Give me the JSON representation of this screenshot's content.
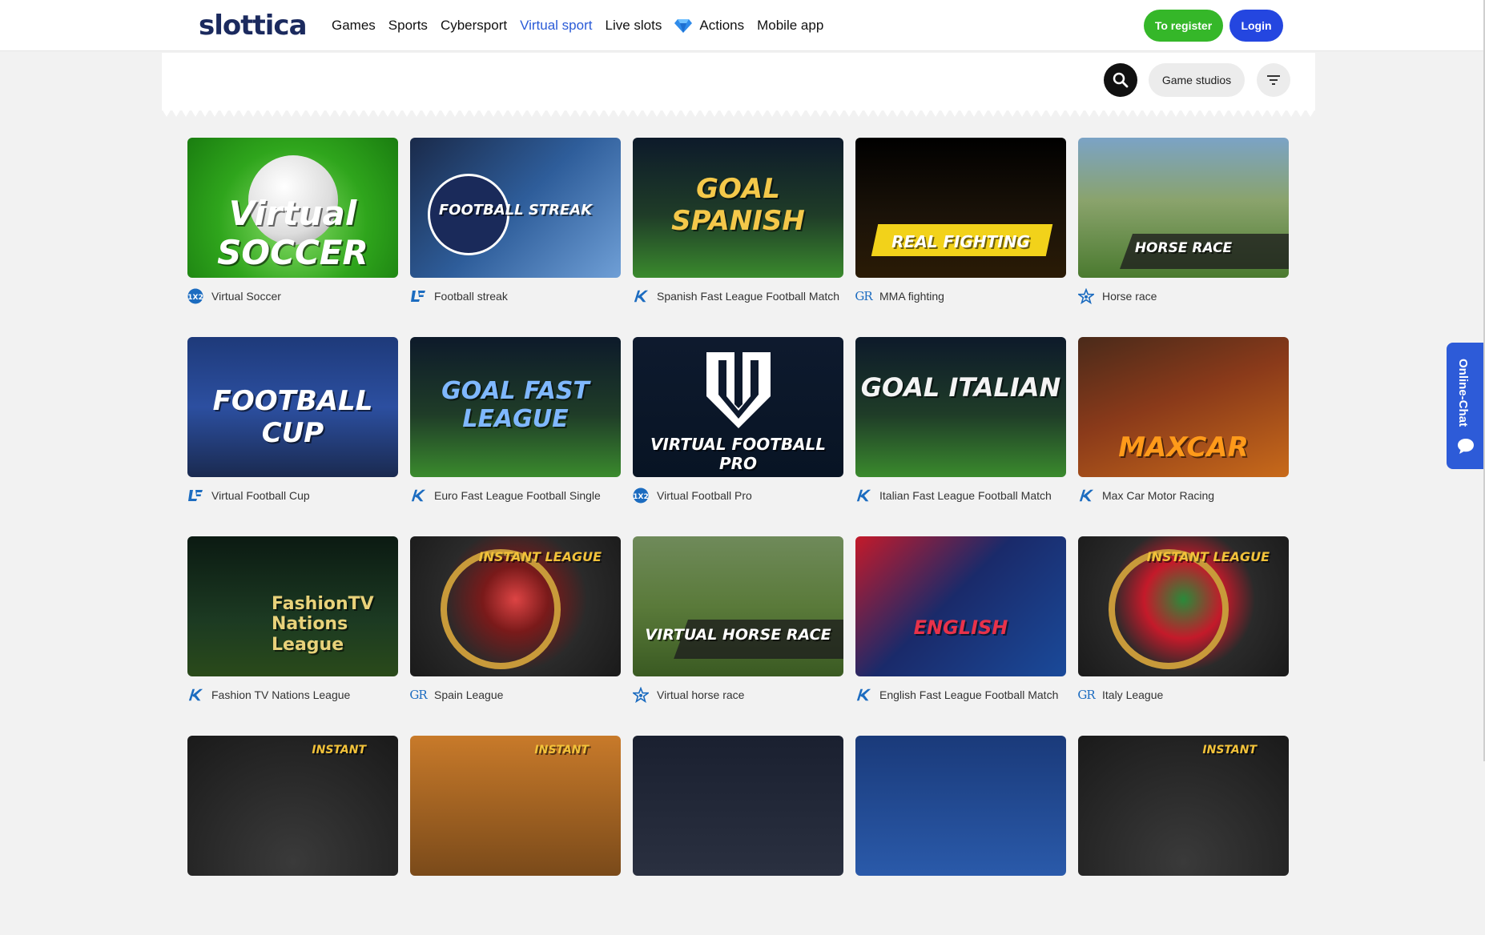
{
  "header": {
    "logo_text": "slottica",
    "nav": [
      {
        "label": "Games",
        "active": false
      },
      {
        "label": "Sports",
        "active": false
      },
      {
        "label": "Cybersport",
        "active": false
      },
      {
        "label": "Virtual sport",
        "active": true
      },
      {
        "label": "Live slots",
        "active": false
      },
      {
        "label": "Actions",
        "active": false,
        "icon": "diamond-icon"
      },
      {
        "label": "Mobile app",
        "active": false
      }
    ],
    "register_label": "To register",
    "login_label": "Login"
  },
  "filters": {
    "studios_label": "Game studios"
  },
  "games": [
    {
      "name": "Virtual Soccer",
      "provider": "1x2",
      "art": "Virtual SOCCER"
    },
    {
      "name": "Football streak",
      "provider": "LE",
      "art": "FOOTBALL STREAK"
    },
    {
      "name": "Spanish Fast League Football Match",
      "provider": "K",
      "art": "GOAL SPANISH"
    },
    {
      "name": "MMA fighting",
      "provider": "GR",
      "art": "REAL FIGHTING"
    },
    {
      "name": "Horse race",
      "provider": "star",
      "art": "HORSE RACE"
    },
    {
      "name": "Virtual Football Cup",
      "provider": "LE",
      "art": "FOOTBALL CUP"
    },
    {
      "name": "Euro Fast League Football Single",
      "provider": "K",
      "art": "GOAL FAST LEAGUE"
    },
    {
      "name": "Virtual Football Pro",
      "provider": "1x2",
      "art": "VIRTUAL FOOTBALL PRO"
    },
    {
      "name": "Italian Fast League Football Match",
      "provider": "K",
      "art": "GOAL ITALIAN"
    },
    {
      "name": "Max Car Motor Racing",
      "provider": "K",
      "art": "MAXCAR"
    },
    {
      "name": "Fashion TV Nations League",
      "provider": "K",
      "art": "FashionTV Nations League"
    },
    {
      "name": "Spain League",
      "provider": "GR",
      "art": "INSTANT LEAGUE"
    },
    {
      "name": "Virtual horse race",
      "provider": "star",
      "art": "VIRTUAL HORSE RACE"
    },
    {
      "name": "English Fast League Football Match",
      "provider": "K",
      "art": "ENGLISH"
    },
    {
      "name": "Italy League",
      "provider": "GR",
      "art": "INSTANT LEAGUE"
    }
  ],
  "partial_row": [
    {
      "art": "INSTANT"
    },
    {
      "art": "INSTANT"
    },
    {
      "art": ""
    },
    {
      "art": ""
    },
    {
      "art": "INSTANT"
    }
  ],
  "chat_label": "Online-Chat",
  "colors": {
    "accent": "#2a5bd7",
    "register": "#35b729",
    "login": "#2446e0",
    "chat": "#2d5bd8"
  }
}
